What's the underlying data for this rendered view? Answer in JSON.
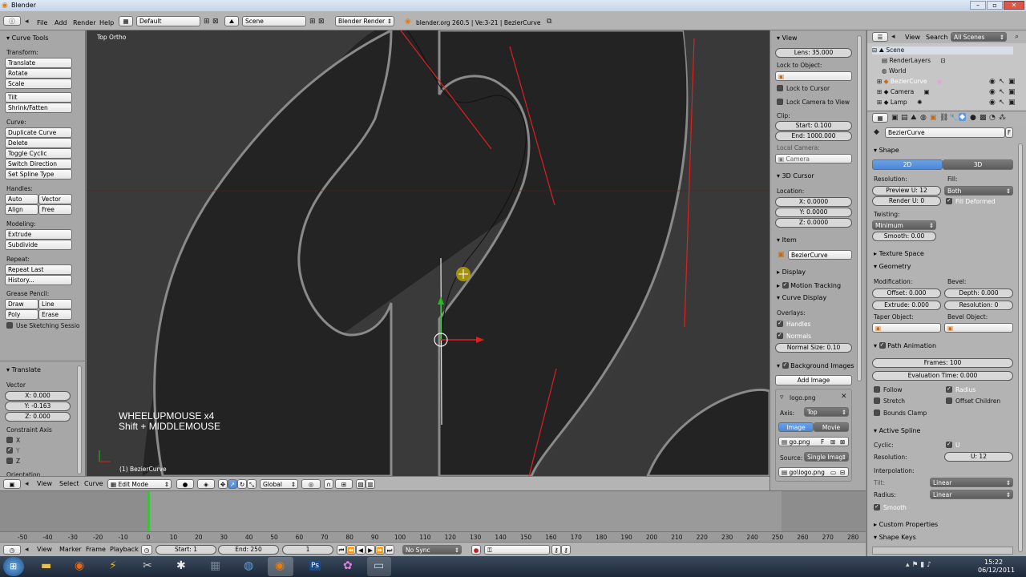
{
  "colors": {
    "accent_blue": "#5b97e6",
    "curve_red": "#e02020",
    "viewport_dark": "#242424",
    "panel": "#b3b3b3"
  },
  "window": {
    "title": "Blender",
    "controls": [
      "–",
      "▫",
      "✕"
    ]
  },
  "topbar": {
    "menus": [
      "File",
      "Add",
      "Render",
      "Help"
    ],
    "layout": "Default",
    "scene": "Scene",
    "engine": "Blender Render",
    "info": "blender.org 260.5 | Ve:3-21 | BezierCurve"
  },
  "toolshelf": {
    "title": "Curve Tools",
    "sections": {
      "transform": "Transform:",
      "curve": "Curve:",
      "handles": "Handles:",
      "modeling": "Modeling:",
      "repeat": "Repeat:",
      "grease": "Grease Pencil:"
    },
    "buttons": {
      "translate": "Translate",
      "rotate": "Rotate",
      "scale": "Scale",
      "tilt": "Tilt",
      "shrink": "Shrink/Fatten",
      "duplicate": "Duplicate Curve",
      "delete": "Delete",
      "toggle_cyclic": "Toggle Cyclic",
      "switch_direction": "Switch Direction",
      "set_spline_type": "Set Spline Type",
      "auto": "Auto",
      "vector": "Vector",
      "align": "Align",
      "free": "Free",
      "extrude": "Extrude",
      "subdivide": "Subdivide",
      "repeat_last": "Repeat Last",
      "history": "History...",
      "draw": "Draw",
      "line": "Line",
      "poly": "Poly",
      "erase": "Erase"
    },
    "use_sketching": "Use Sketching Sessio"
  },
  "operator": {
    "title": "Translate",
    "vector_label": "Vector",
    "x": "X: 0.000",
    "y": "Y: -0.163",
    "z": "Z: 0.000",
    "constraint_label": "Constraint Axis",
    "cx": "X",
    "cy": "Y",
    "cz": "Z",
    "orientation": "Orientation"
  },
  "viewport": {
    "label": "Top Ortho",
    "hint1": "WHEELUPMOUSE x4",
    "hint2": "Shift + MIDDLEMOUSE",
    "object": "(1) BezierCurve"
  },
  "viewheader": {
    "view": "View",
    "select": "Select",
    "curve": "Curve",
    "mode": "Edit Mode",
    "orientation": "Global"
  },
  "npanel": {
    "view_title": "View",
    "lens": "Lens: 35.000",
    "lock_to_object": "Lock to Object:",
    "lock_to_cursor": "Lock to Cursor",
    "lock_camera": "Lock Camera to View",
    "clip": "Clip:",
    "clip_start": "Start: 0.100",
    "clip_end": "End: 1000.000",
    "local_camera": "Local Camera:",
    "camera": "Camera",
    "cursor_title": "3D Cursor",
    "location": "Location:",
    "cx": "X: 0.0000",
    "cy": "Y: 0.0000",
    "cz": "Z: 0.0000",
    "item_title": "Item",
    "item_name": "BezierCurve",
    "display_title": "Display",
    "motion_tracking": "Motion Tracking",
    "curve_display": "Curve Display",
    "overlays": "Overlays:",
    "handles": "Handles",
    "normals": "Normals",
    "normal_size": "Normal Size: 0.10",
    "bg_images": "Background Images",
    "add_image": "Add Image",
    "logo": "logo.png",
    "axis_label": "Axis:",
    "axis_value": "Top",
    "image_tab": "Image",
    "movie_tab": "Movie",
    "image_file": "go.png",
    "image_f": "F",
    "source_label": "Source:",
    "source_value": "Single Imag",
    "filepath": "go\\logo.png"
  },
  "outliner": {
    "view": "View",
    "search": "Search",
    "filter": "All Scenes",
    "items": [
      "Scene",
      "RenderLayers",
      "World",
      "BezierCurve",
      "Camera",
      "Lamp"
    ]
  },
  "properties": {
    "object_name": "BezierCurve",
    "object_f": "F",
    "shape_title": "Shape",
    "tab_2d": "2D",
    "tab_3d": "3D",
    "resolution_label": "Resolution:",
    "fill_label": "Fill:",
    "preview_u": "Preview U: 12",
    "fill_value": "Both",
    "render_u": "Render U: 0",
    "fill_deformed": "Fill Deformed",
    "twisting_label": "Twisting:",
    "twisting_value": "Minimum",
    "smooth": "Smooth: 0.00",
    "texture_space": "Texture Space",
    "geometry": "Geometry",
    "modification_label": "Modification:",
    "bevel_label": "Bevel:",
    "offset": "Offset: 0.000",
    "depth": "Depth: 0.000",
    "extrude": "Extrude: 0.000",
    "bevel_res": "Resolution: 0",
    "taper_label": "Taper Object:",
    "bevel_obj_label": "Bevel Object:",
    "path_animation": "Path Animation",
    "frames": "Frames: 100",
    "eval_time": "Evaluation Time: 0.000",
    "follow": "Follow",
    "radius": "Radius",
    "stretch": "Stretch",
    "offset_children": "Offset Children",
    "bounds_clamp": "Bounds Clamp",
    "active_spline": "Active Spline",
    "cyclic_label": "Cyclic:",
    "cyclic_u": "U",
    "resolution2_label": "Resolution:",
    "res_u": "U: 12",
    "interpolation_label": "Interpolation:",
    "tilt_label": "Tilt:",
    "tilt_value": "Linear",
    "radius_label": "Radius:",
    "radius_value": "Linear",
    "smooth_chk": "Smooth",
    "custom_props": "Custom Properties",
    "shape_keys": "Shape Keys"
  },
  "timeline": {
    "ticks": [
      "-50",
      "-40",
      "-30",
      "-20",
      "-10",
      "0",
      "10",
      "20",
      "30",
      "40",
      "50",
      "60",
      "70",
      "80",
      "90",
      "100",
      "110",
      "120",
      "130",
      "140",
      "150",
      "160",
      "170",
      "180",
      "190",
      "200",
      "210",
      "220",
      "230",
      "240",
      "250",
      "260",
      "270",
      "280"
    ],
    "view": "View",
    "marker": "Marker",
    "frame": "Frame",
    "playback": "Playback",
    "start": "Start: 1",
    "end": "End: 250",
    "current": "1",
    "sync": "No Sync"
  },
  "taskbar": {
    "time": "15:22",
    "date": "06/12/2011"
  }
}
